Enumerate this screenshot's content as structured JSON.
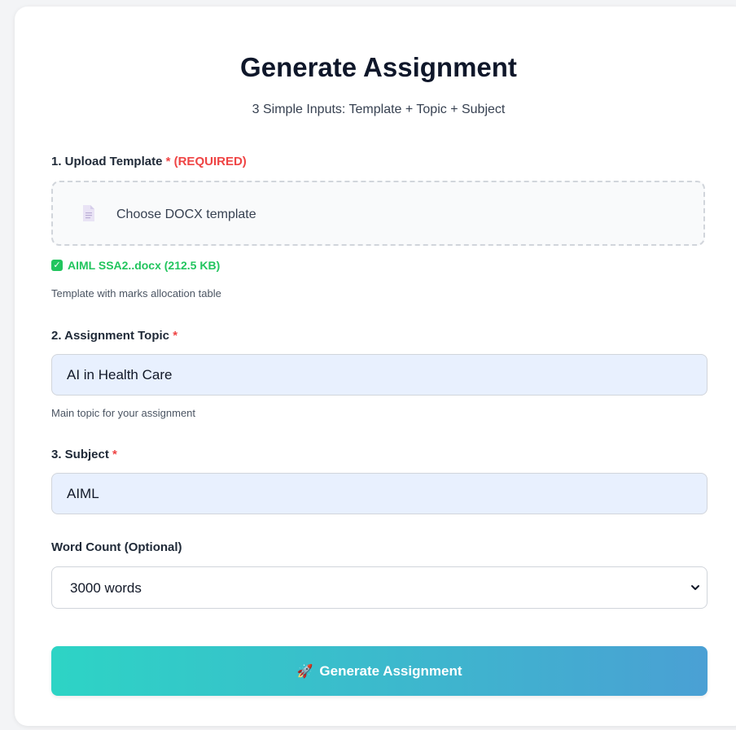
{
  "header": {
    "title": "Generate Assignment",
    "subtitle": "3 Simple Inputs: Template + Topic + Subject"
  },
  "template": {
    "label": "1. Upload Template",
    "required_mark": "*",
    "required_text": "(REQUIRED)",
    "dropzone_text": "Choose DOCX template",
    "file_status": "AIML SSA2..docx (212.5 KB)",
    "help": "Template with marks allocation table"
  },
  "topic": {
    "label": "2. Assignment Topic",
    "required_mark": "*",
    "value": "AI in Health Care",
    "help": "Main topic for your assignment"
  },
  "subject": {
    "label": "3. Subject",
    "required_mark": "*",
    "value": "AIML"
  },
  "word_count": {
    "label": "Word Count (Optional)",
    "selected": "3000 words"
  },
  "submit": {
    "icon": "rocket-icon",
    "label": "Generate Assignment"
  },
  "colors": {
    "required": "#ef4444",
    "success": "#22c55e",
    "button_start": "#2dd4c5",
    "button_end": "#4aa0d4",
    "input_bg": "#e8f0fe"
  }
}
